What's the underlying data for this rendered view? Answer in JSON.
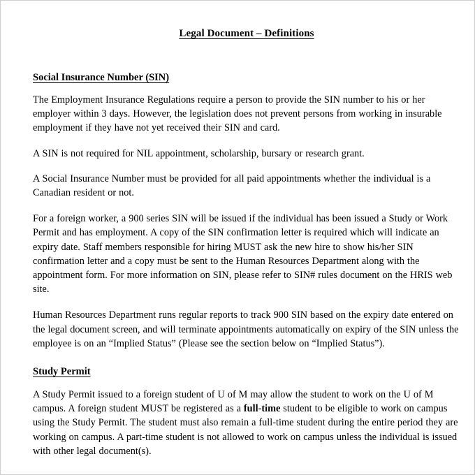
{
  "document": {
    "title": "Legal Document – Definitions",
    "sections": [
      {
        "heading": "Social Insurance Number (SIN)",
        "paragraphs": [
          "The Employment Insurance Regulations require a person to provide the SIN number to his or her employer within 3 days.  However, the legislation does not prevent persons from working in insurable employment if they have not yet received their SIN and card.",
          "A SIN is not required for NIL appointment, scholarship, bursary or research grant.",
          "A Social Insurance Number must be provided for all paid appointments whether the individual is a Canadian resident or not.",
          "For a foreign worker, a 900 series SIN will be issued if the individual has been issued a Study or Work Permit and has employment. A copy of the SIN confirmation letter is required which will indicate an expiry date.  Staff members responsible for hiring MUST ask the new hire to show his/her SIN confirmation letter and a copy must be sent to the Human Resources Department along with the appointment form. For more information on SIN, please refer to SIN# rules document on the HRIS web site.",
          "Human Resources Department runs regular reports to track 900 SIN based on the expiry date entered on the legal document screen, and will terminate appointments automatically on expiry of the SIN unless the employee is on an “Implied Status” (Please see the section below on “Implied Status”)."
        ]
      },
      {
        "heading": "Study Permit",
        "paragraph_parts": {
          "before_bold": "A Study Permit issued to a foreign student of U of M may allow the student to work on the U of M campus. A foreign student MUST be registered as a ",
          "bold": "full-time",
          "after_bold": " student to be eligible to work on campus using the Study Permit. The student must also remain a full-time student during the entire period they are working on campus.   A part-time student is not allowed to work on campus unless the individual is issued with other legal document(s)."
        }
      }
    ]
  }
}
